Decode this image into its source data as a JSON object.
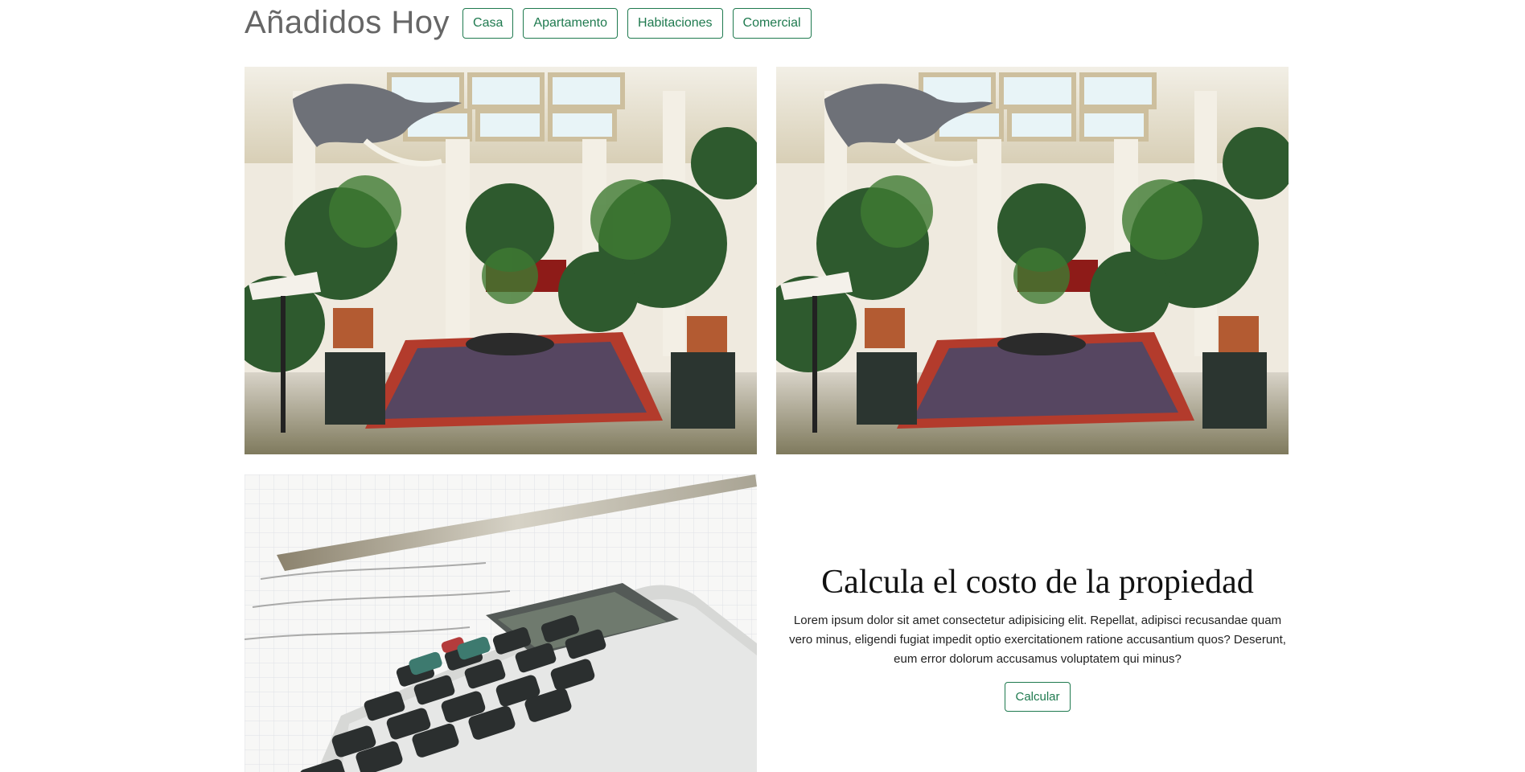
{
  "header": {
    "title": "Añadidos Hoy",
    "filters": [
      "Casa",
      "Apartamento",
      "Habitaciones",
      "Comercial"
    ]
  },
  "listings": {
    "image1_alt": "listing-interior-photo",
    "image2_alt": "listing-interior-photo",
    "calc_image_alt": "calculator-photo"
  },
  "calculator": {
    "title": "Calcula el costo de la propiedad",
    "text": "Lorem ipsum dolor sit amet consectetur adipisicing elit. Repellat, adipisci recusandae quam vero minus, eligendi fugiat impedit optio exercitationem ratione accusantium quos? Deserunt, eum error dolorum accusamus voluptatem qui minus?",
    "button": "Calcular"
  },
  "colors": {
    "accent": "#1f7a4f",
    "title_gray": "#666666"
  }
}
